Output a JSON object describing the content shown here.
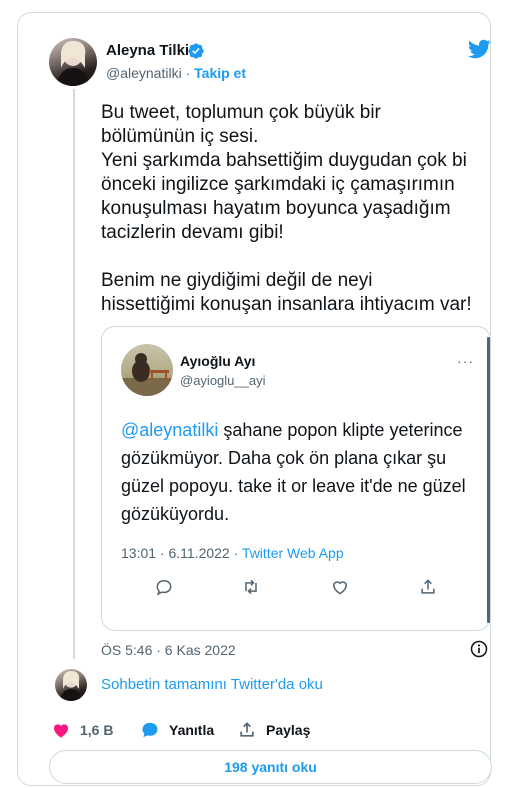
{
  "author": {
    "name": "Aleyna Tilki",
    "handle": "@aleynatilki",
    "separator": "·",
    "follow_label": "Takip et"
  },
  "tweet": {
    "text": "Bu tweet, toplumun çok büyük bir\nbölümünün iç sesi.\nYeni şarkımda bahsettiğim duygudan çok bi\nönceki ingilizce şarkımdaki iç çamaşırımın\nkonuşulması hayatım boyunca yaşadığım\ntacizlerin devamı gibi!\n\nBenim ne giydiğimi değil de neyi\nhissettiğimi konuşan insanlara ihtiyacım var!",
    "timestamp": "ÖS 5:46 · 6 Kas 2022"
  },
  "quoted_tweet": {
    "name": "Ayıoğlu Ayı",
    "handle": "@ayioglu__ayi",
    "more": "···",
    "mention": "@aleynatilki",
    "text": " şahane popon klipte yeterince gözükmüyor. Daha çok ön plana çıkar şu güzel popoyu. take it or leave it'de ne güzel gözüküyordu.",
    "time": "13:01 · 6.11.2022 · ",
    "source": "Twitter Web App"
  },
  "conversation": {
    "link_label": "Sohbetin tamamını Twitter'da oku"
  },
  "actions": {
    "like_count": "1,6 B",
    "reply_label": "Yanıtla",
    "share_label": "Paylaş"
  },
  "replies_button": {
    "label": "198 yanıtı oku"
  },
  "colors": {
    "accent": "#1d9bf0",
    "like": "#f91880",
    "text": "#0f1419",
    "muted": "#536471",
    "border": "#cfd9de"
  },
  "icons": [
    "verified-badge-icon",
    "twitter-bird-icon",
    "more-icon",
    "reply-icon",
    "retweet-icon",
    "like-icon",
    "share-icon",
    "info-icon",
    "heart-icon",
    "speech-bubble-icon",
    "upload-icon"
  ]
}
